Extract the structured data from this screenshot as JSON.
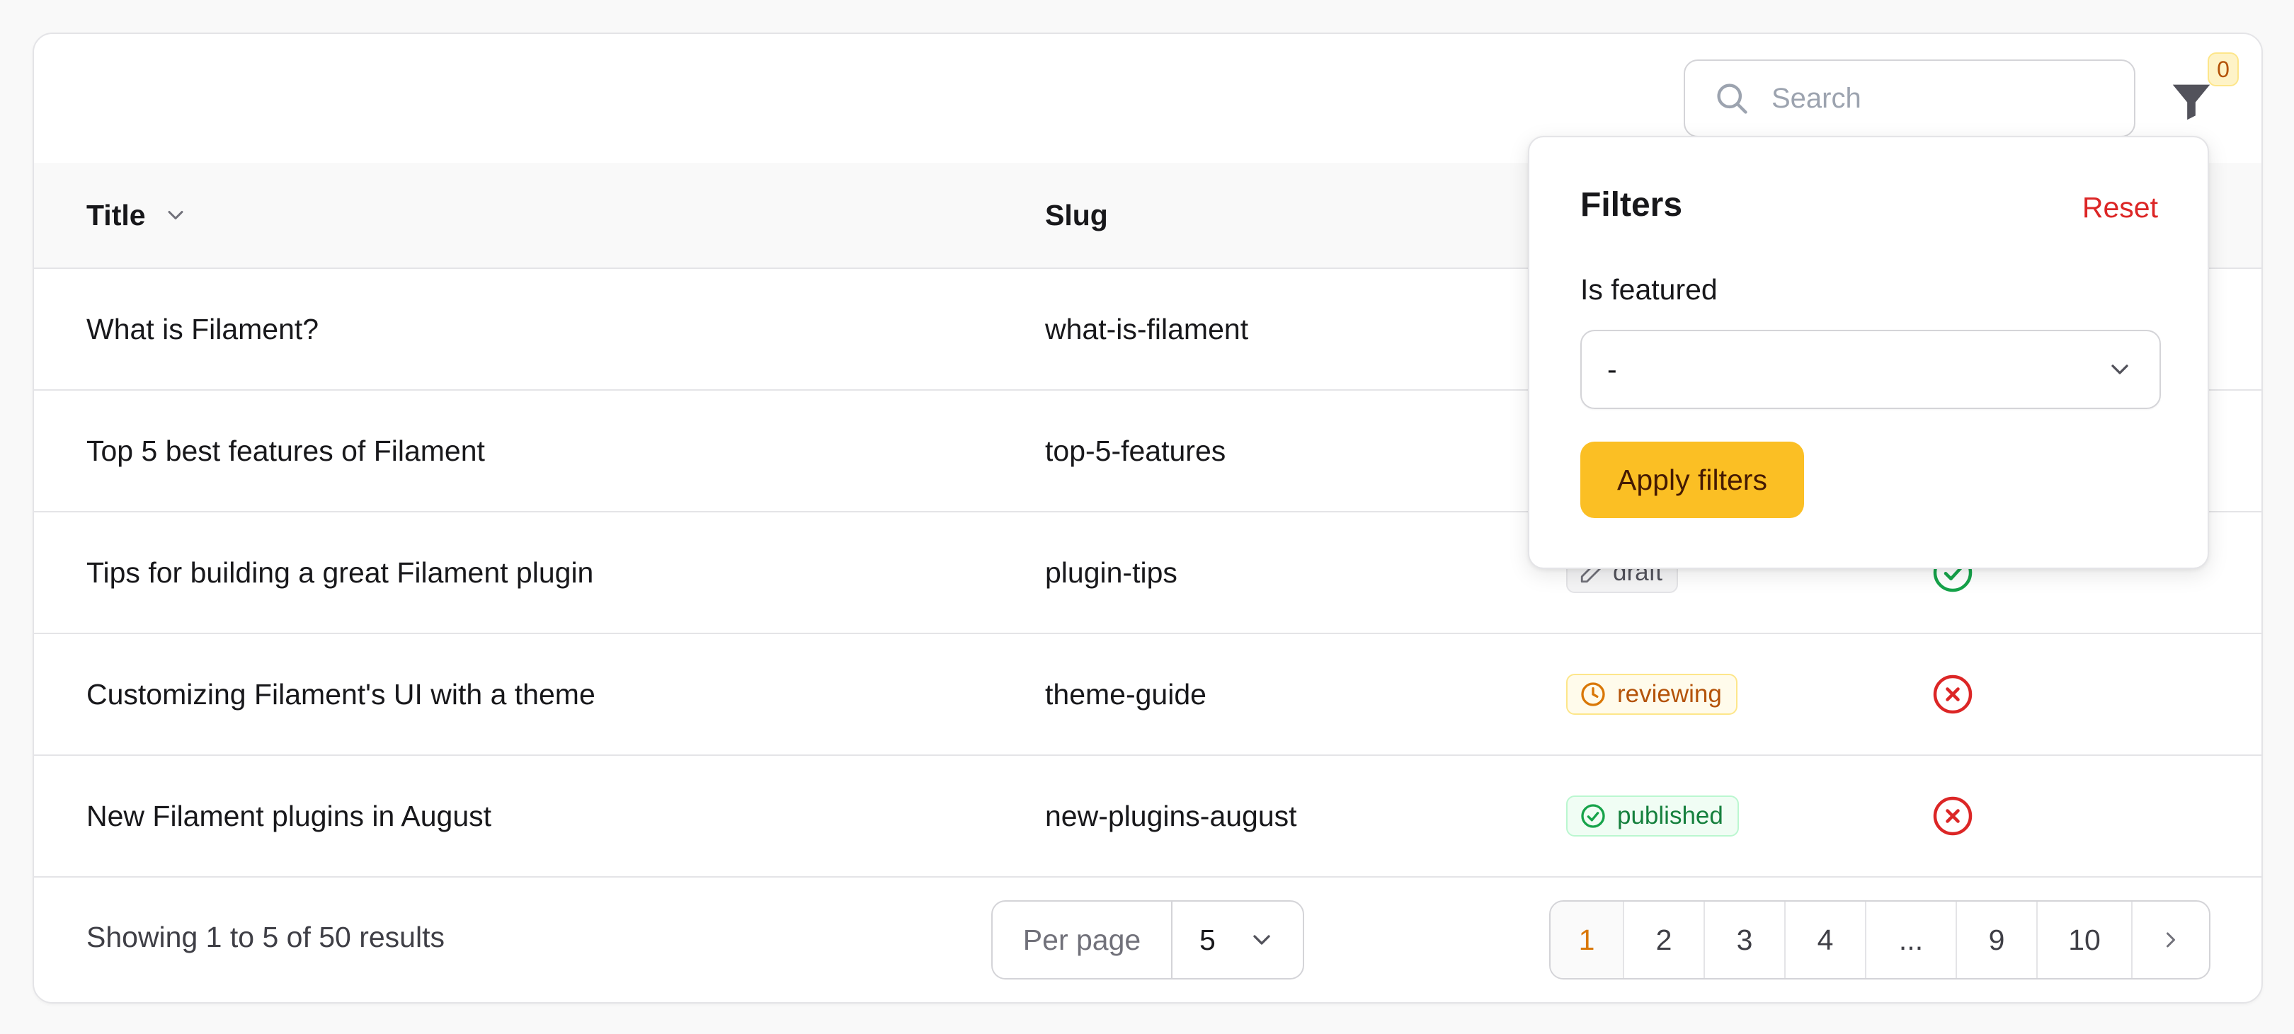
{
  "search": {
    "placeholder": "Search",
    "value": ""
  },
  "filters": {
    "active_count": "0",
    "dropdown_title": "Filters",
    "reset_label": "Reset",
    "is_featured_label": "Is featured",
    "is_featured_value": "-",
    "apply_label": "Apply filters"
  },
  "table": {
    "headers": {
      "title": "Title",
      "slug": "Slug"
    },
    "rows": [
      {
        "title": "What is Filament?",
        "slug": "what-is-filament",
        "status": "",
        "featured": ""
      },
      {
        "title": "Top 5 best features of Filament",
        "slug": "top-5-features",
        "status": "",
        "featured": ""
      },
      {
        "title": "Tips for building a great Filament plugin",
        "slug": "plugin-tips",
        "status": "draft",
        "featured": "yes"
      },
      {
        "title": "Customizing Filament's UI with a theme",
        "slug": "theme-guide",
        "status": "reviewing",
        "featured": "no"
      },
      {
        "title": "New Filament plugins in August",
        "slug": "new-plugins-august",
        "status": "published",
        "featured": "no"
      }
    ]
  },
  "footer": {
    "showing": "Showing 1 to 5 of 50 results",
    "per_page_label": "Per page",
    "per_page_value": "5",
    "pages": [
      "1",
      "2",
      "3",
      "4",
      "...",
      "9",
      "10"
    ],
    "current_page": "1"
  },
  "colors": {
    "accent": "#fbbf24",
    "danger": "#dc2626",
    "success": "#16a34a",
    "warning": "#d97706"
  },
  "icons": {
    "search": "search-icon",
    "filter": "funnel-icon",
    "sort": "chevron-down-icon",
    "draft": "pencil-icon",
    "reviewing": "clock-icon",
    "published": "check-circle-icon",
    "featured_yes": "check-circle-icon",
    "featured_no": "x-circle-icon",
    "next": "chevron-right-icon"
  }
}
